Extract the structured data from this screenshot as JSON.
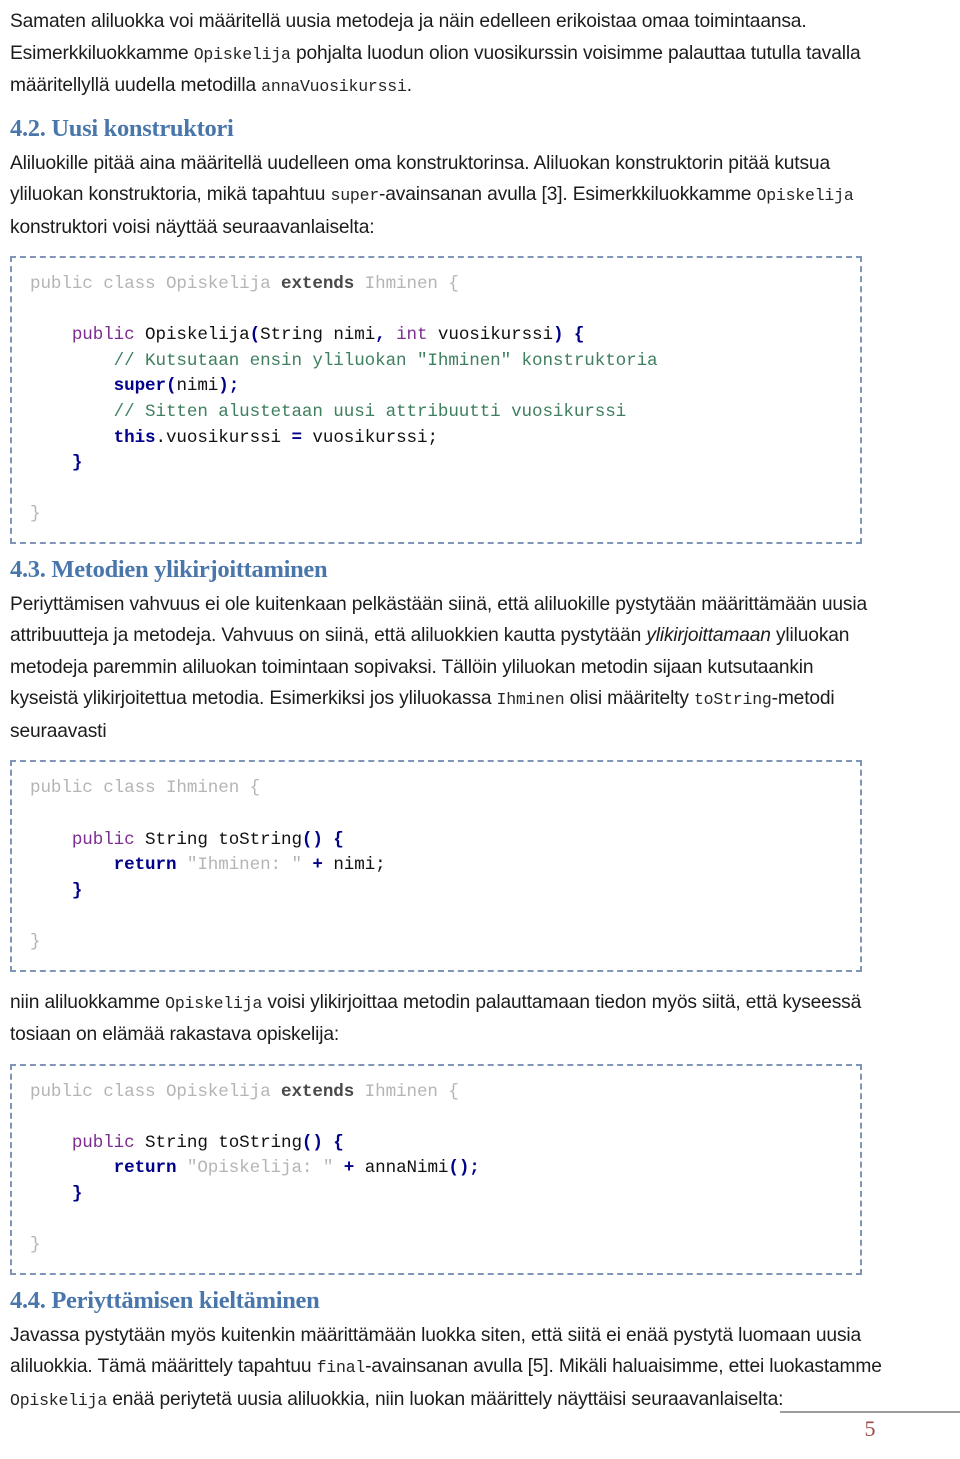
{
  "document": {
    "language": "fi",
    "page_number": "5"
  },
  "intro": {
    "para1_a": "Samaten aliluokka voi määritellä uusia metodeja ja näin edelleen erikoistaa omaa toimintaansa.",
    "para2_a": "Esimerkkiluokkamme ",
    "para2_code1": "Opiskelija",
    "para2_b": " pohjalta luodun olion vuosikurssin voisimme palauttaa tutulla tavalla määritellyllä uudella metodilla ",
    "para2_code2": "annaVuosikurssi",
    "para2_c": "."
  },
  "section_42": {
    "heading": "4.2. Uusi konstruktori",
    "para_a": "Aliluokille pitää aina määritellä uudelleen oma konstruktorinsa. Aliluokan konstruktorin pitää kutsua yliluokan konstruktoria, mikä tapahtuu ",
    "para_code1": "super",
    "para_b": "-avainsanan avulla [3]. Esimerkkiluokkamme ",
    "para_code2": "Opiskelija",
    "para_c": " konstruktori voisi näyttää seuraavanlaiselta:"
  },
  "code_block_1": {
    "name": "Opiskelija-konstruktori",
    "lines": [
      {
        "tokens": [
          {
            "t": "public class Opiskelija ",
            "c": "t-dim"
          },
          {
            "t": "extends",
            "c": "t-dimb"
          },
          {
            "t": " Ihminen {",
            "c": "t-dim"
          }
        ]
      },
      {
        "tokens": [
          {
            "t": "",
            "c": "t-plain"
          }
        ]
      },
      {
        "tokens": [
          {
            "t": "    ",
            "c": "t-plain"
          },
          {
            "t": "public",
            "c": "t-kw"
          },
          {
            "t": " Opiskelija",
            "c": "t-plain"
          },
          {
            "t": "(",
            "c": "t-bold"
          },
          {
            "t": "String nimi",
            "c": "t-plain"
          },
          {
            "t": ",",
            "c": "t-bold"
          },
          {
            "t": " ",
            "c": "t-plain"
          },
          {
            "t": "int",
            "c": "t-kw2"
          },
          {
            "t": " vuosikurssi",
            "c": "t-plain"
          },
          {
            "t": ") {",
            "c": "t-bold"
          }
        ]
      },
      {
        "tokens": [
          {
            "t": "        ",
            "c": "t-plain"
          },
          {
            "t": "// Kutsutaan ensin yliluokan \"Ihminen\" konstruktoria",
            "c": "t-cmt"
          }
        ]
      },
      {
        "tokens": [
          {
            "t": "        ",
            "c": "t-plain"
          },
          {
            "t": "super",
            "c": "t-bold"
          },
          {
            "t": "(",
            "c": "t-bold"
          },
          {
            "t": "nimi",
            "c": "t-plain"
          },
          {
            "t": ");",
            "c": "t-bold"
          }
        ]
      },
      {
        "tokens": [
          {
            "t": "        ",
            "c": "t-plain"
          },
          {
            "t": "// Sitten alustetaan uusi attribuutti vuosikurssi",
            "c": "t-cmt"
          }
        ]
      },
      {
        "tokens": [
          {
            "t": "        ",
            "c": "t-plain"
          },
          {
            "t": "this",
            "c": "t-bold"
          },
          {
            "t": ".vuosikurssi ",
            "c": "t-plain"
          },
          {
            "t": "=",
            "c": "t-bold"
          },
          {
            "t": " vuosikurssi;",
            "c": "t-plain"
          }
        ]
      },
      {
        "tokens": [
          {
            "t": "    ",
            "c": "t-plain"
          },
          {
            "t": "}",
            "c": "t-bold"
          }
        ]
      },
      {
        "tokens": [
          {
            "t": "",
            "c": "t-plain"
          }
        ]
      },
      {
        "tokens": [
          {
            "t": "}",
            "c": "t-dim"
          }
        ]
      }
    ]
  },
  "section_43": {
    "heading": "4.3. Metodien ylikirjoittaminen",
    "para_a": "Periyttämisen vahvuus ei ole kuitenkaan pelkästään siinä, että aliluokille pystytään määrittämään uusia attribuutteja ja metodeja. Vahvuus on siinä, että aliluokkien kautta pystytään ",
    "para_italic": "ylikirjoittamaan",
    "para_b": " yliluokan metodeja paremmin aliluokan toimintaan sopivaksi. Tällöin yliluokan metodin sijaan kutsutaankin kyseistä ylikirjoitettua metodia. Esimerkiksi jos yliluokassa ",
    "para_code1": "Ihminen",
    "para_c": " olisi määritelty ",
    "para_code2": "toString",
    "para_d": "-metodi seuraavasti"
  },
  "code_block_2": {
    "name": "Ihminen-toString",
    "lines": [
      {
        "tokens": [
          {
            "t": "public class Ihminen {",
            "c": "t-dim"
          }
        ]
      },
      {
        "tokens": [
          {
            "t": "",
            "c": "t-plain"
          }
        ]
      },
      {
        "tokens": [
          {
            "t": "    ",
            "c": "t-plain"
          },
          {
            "t": "public",
            "c": "t-kw"
          },
          {
            "t": " String toString",
            "c": "t-plain"
          },
          {
            "t": "() {",
            "c": "t-bold"
          }
        ]
      },
      {
        "tokens": [
          {
            "t": "        ",
            "c": "t-plain"
          },
          {
            "t": "return",
            "c": "t-bold"
          },
          {
            "t": " ",
            "c": "t-plain"
          },
          {
            "t": "\"Ihminen: \"",
            "c": "t-str"
          },
          {
            "t": " ",
            "c": "t-plain"
          },
          {
            "t": "+",
            "c": "t-bold"
          },
          {
            "t": " nimi;",
            "c": "t-plain"
          }
        ]
      },
      {
        "tokens": [
          {
            "t": "    ",
            "c": "t-plain"
          },
          {
            "t": "}",
            "c": "t-bold"
          }
        ]
      },
      {
        "tokens": [
          {
            "t": "",
            "c": "t-plain"
          }
        ]
      },
      {
        "tokens": [
          {
            "t": "}",
            "c": "t-dim"
          }
        ]
      }
    ]
  },
  "between": {
    "para_a": "niin aliluokkamme ",
    "para_code1": "Opiskelija",
    "para_b": " voisi ylikirjoittaa metodin palauttamaan tiedon myös siitä, että kyseessä tosiaan on elämää rakastava opiskelija:"
  },
  "code_block_3": {
    "name": "Opiskelija-toString",
    "lines": [
      {
        "tokens": [
          {
            "t": "public class Opiskelija ",
            "c": "t-dim"
          },
          {
            "t": "extends",
            "c": "t-dimb"
          },
          {
            "t": " Ihminen {",
            "c": "t-dim"
          }
        ]
      },
      {
        "tokens": [
          {
            "t": "",
            "c": "t-plain"
          }
        ]
      },
      {
        "tokens": [
          {
            "t": "    ",
            "c": "t-plain"
          },
          {
            "t": "public",
            "c": "t-kw"
          },
          {
            "t": " String toString",
            "c": "t-plain"
          },
          {
            "t": "() {",
            "c": "t-bold"
          }
        ]
      },
      {
        "tokens": [
          {
            "t": "        ",
            "c": "t-plain"
          },
          {
            "t": "return",
            "c": "t-bold"
          },
          {
            "t": " ",
            "c": "t-plain"
          },
          {
            "t": "\"Opiskelija: \"",
            "c": "t-str"
          },
          {
            "t": " ",
            "c": "t-plain"
          },
          {
            "t": "+",
            "c": "t-bold"
          },
          {
            "t": " annaNimi",
            "c": "t-plain"
          },
          {
            "t": "();",
            "c": "t-bold"
          }
        ]
      },
      {
        "tokens": [
          {
            "t": "    ",
            "c": "t-plain"
          },
          {
            "t": "}",
            "c": "t-bold"
          }
        ]
      },
      {
        "tokens": [
          {
            "t": "",
            "c": "t-plain"
          }
        ]
      },
      {
        "tokens": [
          {
            "t": "}",
            "c": "t-dim"
          }
        ]
      }
    ]
  },
  "section_44": {
    "heading": "4.4. Periyttämisen kieltäminen",
    "para_a": "Javassa pystytään myös kuitenkin määrittämään luokka siten, että siitä ei enää pystytä luomaan uusia aliluokkia. Tämä määrittely tapahtuu ",
    "para_code1": "final",
    "para_b": "-avainsanan avulla [5]. Mikäli haluaisimme, ettei luokastamme ",
    "para_code2": "Opiskelija",
    "para_c": " enää periytetä uusia aliluokkia, niin luokan määrittely näyttäisi seuraavanlaiselta:"
  },
  "colors": {
    "heading_blue": "#4a77ab",
    "code_border": "#8096b8",
    "comment_green": "#3f7f5f",
    "keyword_purple": "#7d2e91",
    "punct_navy": "#00008b",
    "dim_gray": "#b5b5b5",
    "page_number_maroon": "#9e4a4a",
    "footer_rule_gray": "#9c9c9c"
  }
}
